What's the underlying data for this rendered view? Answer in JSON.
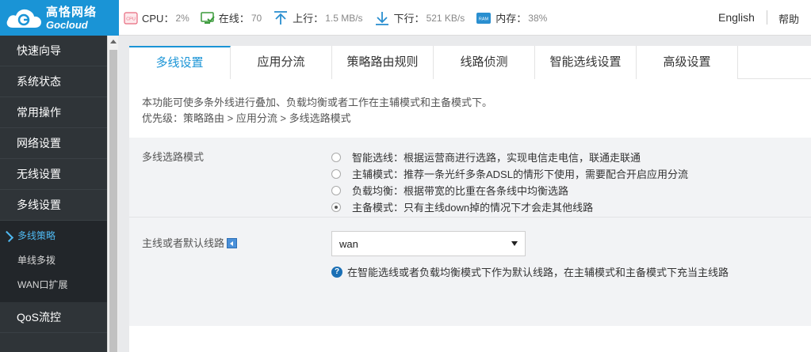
{
  "brand": {
    "name_cn": "高恪网络",
    "name_en": "Gocloud"
  },
  "status": {
    "cpu_label": "CPU：",
    "cpu_value": "2%",
    "online_label": "在线：",
    "online_value": "70",
    "up_label": "上行：",
    "up_value": "1.5 MB/s",
    "down_label": "下行：",
    "down_value": "521 KB/s",
    "mem_label": "内存：",
    "mem_value": "38%",
    "cpu_icon_text": "CPU",
    "ram_icon_text": "RAM"
  },
  "header": {
    "language": "English",
    "help": "帮助"
  },
  "sidebar": {
    "items": [
      "快速向导",
      "系统状态",
      "常用操作",
      "网络设置",
      "无线设置",
      "多线设置"
    ],
    "sub_items": [
      "多线策略",
      "单线多拨",
      "WAN口扩展"
    ],
    "bottom_item": "QoS流控"
  },
  "tabs": [
    "多线设置",
    "应用分流",
    "策略路由规则",
    "线路侦测",
    "智能选线设置",
    "高级设置"
  ],
  "description": {
    "line1": "本功能可使多条外线进行叠加、负载均衡或者工作在主辅模式和主备模式下。",
    "line2": "优先级：策略路由 > 应用分流 > 多线选路模式"
  },
  "mode": {
    "label": "多线选路模式",
    "options": [
      "智能选线：根据运营商进行选路，实现电信走电信，联通走联通",
      "主辅模式：推荐一条光纤多条ADSL的情形下使用，需要配合开启应用分流",
      "负载均衡：根据带宽的比重在各条线中均衡选路",
      "主备模式：只有主线down掉的情况下才会走其他线路"
    ],
    "selected_index": 3
  },
  "default_line": {
    "label": "主线或者默认线路",
    "value": "wan",
    "hint": "在智能选线或者负载均衡模式下作为默认线路，在主辅模式和主备模式下充当主线路"
  },
  "colors": {
    "accent": "#1a94d6",
    "sidebar_bg": "#2f3438",
    "active_sub": "#4fb8f0"
  }
}
